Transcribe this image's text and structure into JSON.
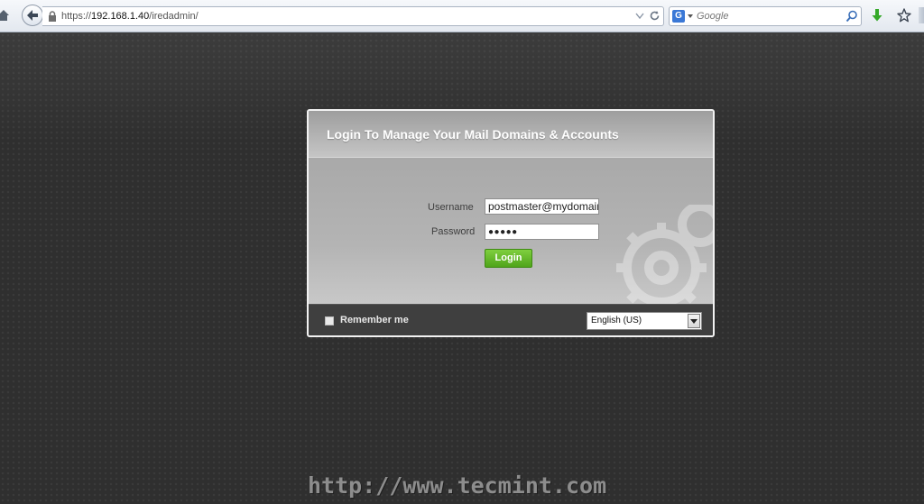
{
  "browser": {
    "url_prefix": "https://",
    "url_host": "192.168.1.40",
    "url_path": "/iredadmin/",
    "search_placeholder": "Google",
    "search_engine_icon": "G",
    "icons": [
      "home-icon",
      "back-arrow-icon",
      "lock-icon",
      "url-dropdown-icon",
      "reload-icon",
      "search-engine-icon",
      "magnifier-icon",
      "download-arrow-icon",
      "bookmark-star-icon"
    ]
  },
  "login": {
    "title": "Login To Manage Your Mail Domains & Accounts",
    "username_label": "Username",
    "username_value": "postmaster@mydomain",
    "password_label": "Password",
    "password_value": "●●●●●",
    "login_button": "Login",
    "remember_label": "Remember me",
    "remember_checked": false,
    "language_selected": "English (US)"
  },
  "colors": {
    "page_bg": "#2f2f2f",
    "login_button": "#5cb224",
    "footer_bg": "#3f3f3f"
  },
  "watermark": "http://www.tecmint.com"
}
